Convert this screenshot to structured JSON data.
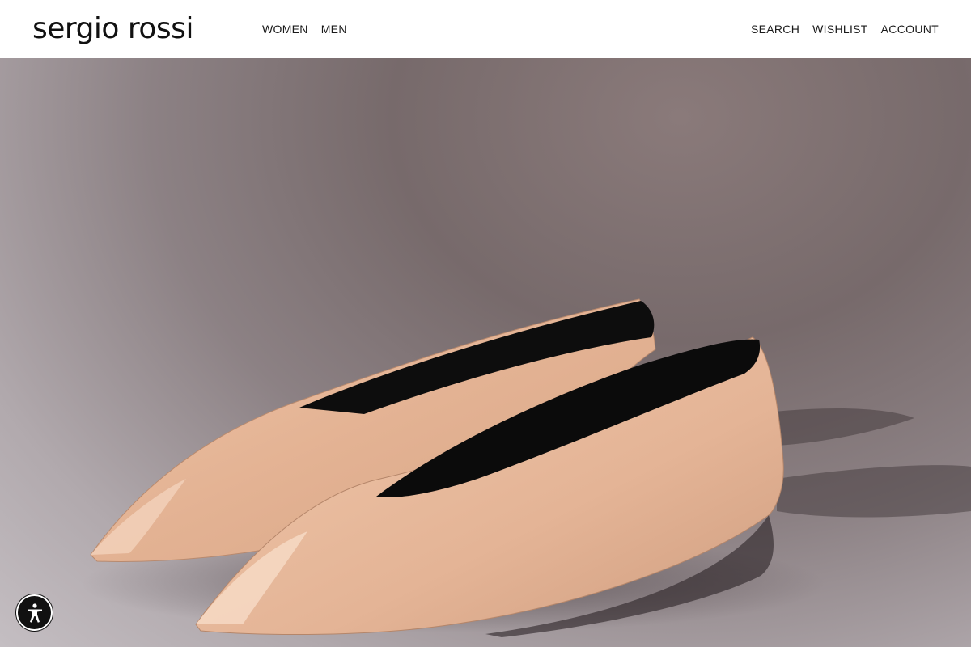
{
  "header": {
    "logo": "sergio rossi",
    "nav_left": [
      "WOMEN",
      "MEN"
    ],
    "nav_right": [
      "SEARCH",
      "WISHLIST",
      "ACCOUNT"
    ]
  },
  "hero": {
    "image_subject": "nude leather pointed flats",
    "colors": {
      "background": "#8a7f82",
      "leather": "#e6b99a",
      "lining": "#0e0e0e"
    }
  },
  "accessibility": {
    "icon": "accessibility-icon"
  }
}
